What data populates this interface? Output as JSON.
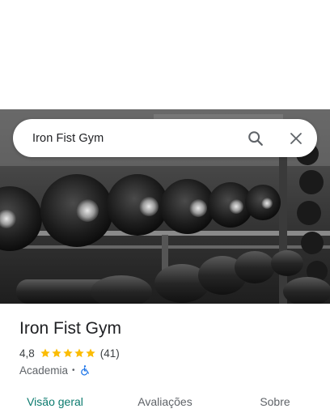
{
  "search": {
    "query": "Iron Fist Gym"
  },
  "icons": {
    "search": "search-icon",
    "close": "close-icon",
    "star": "star-icon",
    "accessibility": "wheelchair-icon"
  },
  "place": {
    "name": "Iron Fist Gym",
    "rating": "4,8",
    "stars": 5,
    "review_count": "(41)",
    "category": "Academia",
    "separator": "•"
  },
  "tabs": [
    {
      "label": "Visão geral",
      "active": true
    },
    {
      "label": "Avaliações",
      "active": false
    },
    {
      "label": "Sobre",
      "active": false
    }
  ],
  "colors": {
    "accent": "#0b7a6e",
    "star": "#fbbc04",
    "accessibility_icon": "#1a73e8"
  }
}
